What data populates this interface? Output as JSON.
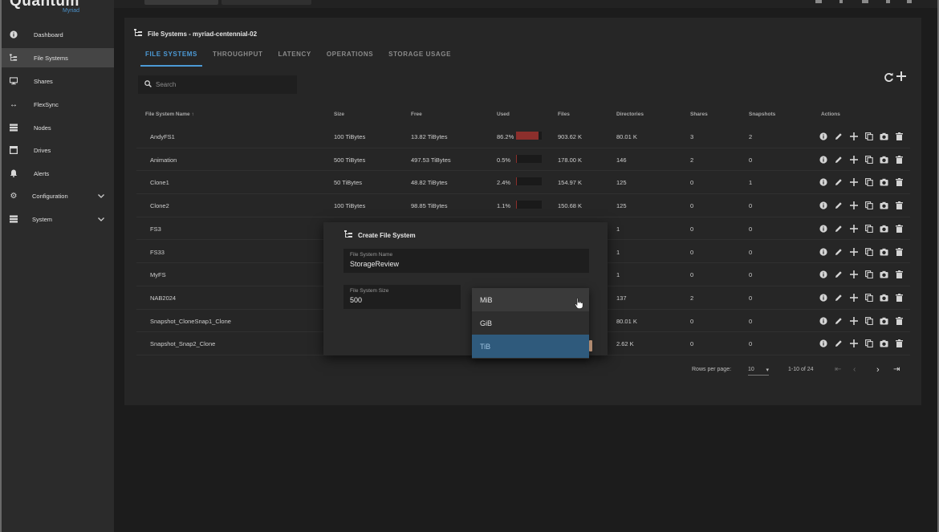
{
  "app": {
    "logo": "Quantum",
    "logo_sub": "Myriad"
  },
  "sidebar": {
    "items": [
      {
        "label": "Dashboard",
        "icon": "info-icon"
      },
      {
        "label": "File Systems",
        "icon": "tree-icon"
      },
      {
        "label": "Shares",
        "icon": "monitor-icon"
      },
      {
        "label": "FlexSync",
        "icon": "arrows-icon"
      },
      {
        "label": "Nodes",
        "icon": "server-icon"
      },
      {
        "label": "Drives",
        "icon": "drive-icon"
      },
      {
        "label": "Alerts",
        "icon": "bell-icon"
      },
      {
        "label": "Configuration",
        "icon": "gear-icon"
      },
      {
        "label": "System",
        "icon": "list-icon"
      }
    ]
  },
  "page": {
    "title": "File Systems - myriad-centennial-02",
    "tabs": [
      "FILE SYSTEMS",
      "THROUGHPUT",
      "LATENCY",
      "OPERATIONS",
      "STORAGE USAGE"
    ]
  },
  "search": {
    "placeholder": "Search"
  },
  "table": {
    "headers": [
      "File System Name",
      "Size",
      "Free",
      "Used",
      "Files",
      "Directories",
      "Shares",
      "Snapshots",
      "Actions"
    ],
    "rows": [
      {
        "name": "AndyFS1",
        "size": "100 TiBytes",
        "free": "13.82 TiBytes",
        "used": "86.2%",
        "used_frac": 0.862,
        "files": "903.62 K",
        "dirs": "80.01 K",
        "shares": "3",
        "snapshots": "2"
      },
      {
        "name": "Animation",
        "size": "500 TiBytes",
        "free": "497.53 TiBytes",
        "used": "0.5%",
        "used_frac": 0.005,
        "files": "178.00 K",
        "dirs": "146",
        "shares": "2",
        "snapshots": "0"
      },
      {
        "name": "Clone1",
        "size": "50 TiBytes",
        "free": "48.82 TiBytes",
        "used": "2.4%",
        "used_frac": 0.024,
        "files": "154.97 K",
        "dirs": "125",
        "shares": "0",
        "snapshots": "1"
      },
      {
        "name": "Clone2",
        "size": "100 TiBytes",
        "free": "98.85 TiBytes",
        "used": "1.1%",
        "used_frac": 0.011,
        "files": "150.68 K",
        "dirs": "125",
        "shares": "0",
        "snapshots": "0"
      },
      {
        "name": "FS3",
        "dirs": "1",
        "shares": "0",
        "snapshots": "0"
      },
      {
        "name": "FS33",
        "dirs": "1",
        "shares": "0",
        "snapshots": "0"
      },
      {
        "name": "MyFS",
        "dirs": "1",
        "shares": "0",
        "snapshots": "0"
      },
      {
        "name": "NAB2024",
        "dirs": "137",
        "shares": "2",
        "snapshots": "0"
      },
      {
        "name": "Snapshot_CloneSnap1_Clone",
        "dirs": "80.01 K",
        "shares": "0",
        "snapshots": "0"
      },
      {
        "name": "Snapshot_Snap2_Clone",
        "dirs": "2.62 K",
        "shares": "0",
        "snapshots": "0"
      }
    ],
    "action_icons": [
      "info-icon",
      "edit-icon",
      "add-icon",
      "copy-icon",
      "snapshot-icon",
      "delete-icon"
    ]
  },
  "pagination": {
    "rows_label": "Rows per page:",
    "rows_value": "10",
    "range": "1-10 of 24"
  },
  "dialog": {
    "title": "Create File System",
    "name_label": "File System Name",
    "name_value": "StorageReview",
    "size_label": "File System Size",
    "size_value": "500",
    "unit_options": [
      "MiB",
      "GiB",
      "TiB"
    ],
    "selected_unit": "TiB"
  }
}
